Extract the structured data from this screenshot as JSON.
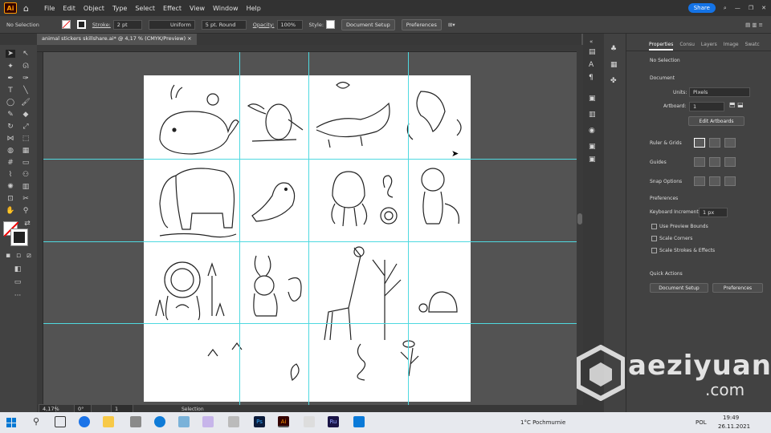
{
  "app": {
    "logo": "Ai",
    "menus": [
      "File",
      "Edit",
      "Object",
      "Type",
      "Select",
      "Effect",
      "View",
      "Window",
      "Help"
    ],
    "share": "Share"
  },
  "control": {
    "selection": "No Selection",
    "stroke_label": "Stroke:",
    "stroke_weight": "2 pt",
    "stroke_profile": "Uniform",
    "brush": "5 pt. Round",
    "opacity_label": "Opacity:",
    "opacity": "100%",
    "style_label": "Style:",
    "doc_setup": "Document Setup",
    "prefs": "Preferences"
  },
  "document": {
    "tab_title": "animal stickers skillshare.ai* @ 4,17 % (CMYK/Preview)",
    "close": "×"
  },
  "status": {
    "zoom": "4,17%",
    "rotation": "0°",
    "artboard": "1",
    "tool": "Selection"
  },
  "panel": {
    "tabs": [
      "Properties",
      "Consu",
      "Layers",
      "Image",
      "Swatc"
    ],
    "no_selection": "No Selection",
    "document_heading": "Document",
    "units_label": "Units:",
    "units_value": "Pixels",
    "artboard_label": "Artboard:",
    "artboard_value": "1",
    "edit_artboards": "Edit Artboards",
    "rulers_grids": "Ruler & Grids",
    "guides": "Guides",
    "snap_options": "Snap Options",
    "preferences_heading": "Preferences",
    "kb_inc_label": "Keyboard Increment:",
    "kb_inc_value": "1 px",
    "opt_preview_bounds": "Use Preview Bounds",
    "opt_scale_corners": "Scale Corners",
    "opt_scale_strokes": "Scale Strokes & Effects",
    "quick_actions": "Quick Actions",
    "qa_doc_setup": "Document Setup",
    "qa_prefs": "Preferences"
  },
  "taskbar": {
    "weather": "1°C Pochmurnie",
    "lang": "POL",
    "time": "19:49",
    "date": "26.11.2021"
  },
  "watermark": {
    "name": "aeziyuan",
    "domain": ".com"
  },
  "colors": {
    "accent": "#1473e6",
    "guide": "#4fd9e0",
    "ai_orange": "#ff9a00"
  }
}
